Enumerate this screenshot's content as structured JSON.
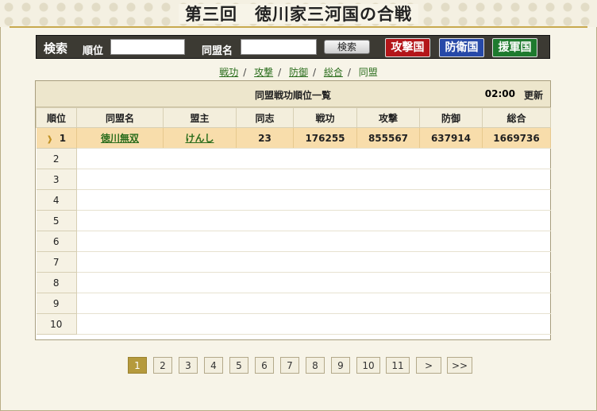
{
  "page": {
    "title": "第三回　徳川家三河国の合戦"
  },
  "search": {
    "label": "検索",
    "rank_label": "順位",
    "rank_value": "",
    "alliance_label": "同盟名",
    "alliance_value": "",
    "search_button": "検索",
    "attack_button": "攻撃国",
    "defense_button": "防衛国",
    "support_button": "援軍国"
  },
  "tabs": [
    {
      "label": "戦功",
      "active": false
    },
    {
      "label": "攻撃",
      "active": false
    },
    {
      "label": "防御",
      "active": false
    },
    {
      "label": "総合",
      "active": false
    },
    {
      "label": "同盟",
      "active": true
    }
  ],
  "table": {
    "title": "同盟戦功順位一覧",
    "time": "02:00",
    "refresh_label": "更新",
    "columns": [
      "順位",
      "同盟名",
      "盟主",
      "同志",
      "戦功",
      "攻撃",
      "防御",
      "総合"
    ],
    "rows": [
      {
        "rank": "1",
        "alliance": "徳川無双",
        "leader": "けんし",
        "members": "23",
        "merit": "176255",
        "attack": "855567",
        "defense": "637914",
        "total": "1669736"
      },
      {
        "rank": "2"
      },
      {
        "rank": "3"
      },
      {
        "rank": "4"
      },
      {
        "rank": "5"
      },
      {
        "rank": "6"
      },
      {
        "rank": "7"
      },
      {
        "rank": "8"
      },
      {
        "rank": "9"
      },
      {
        "rank": "10"
      }
    ]
  },
  "pager": {
    "pages": [
      "1",
      "2",
      "3",
      "4",
      "5",
      "6",
      "7",
      "8",
      "9",
      "10",
      "11"
    ],
    "current": "1",
    "next": ">",
    "last": ">>"
  },
  "colors": {
    "accent_gold": "#b59a3d",
    "highlight_row": "#f8ddab",
    "attack_red": "#b4161a",
    "defense_blue": "#2749a8",
    "support_green": "#1e7a2e",
    "link_green": "#2a6d1c"
  }
}
